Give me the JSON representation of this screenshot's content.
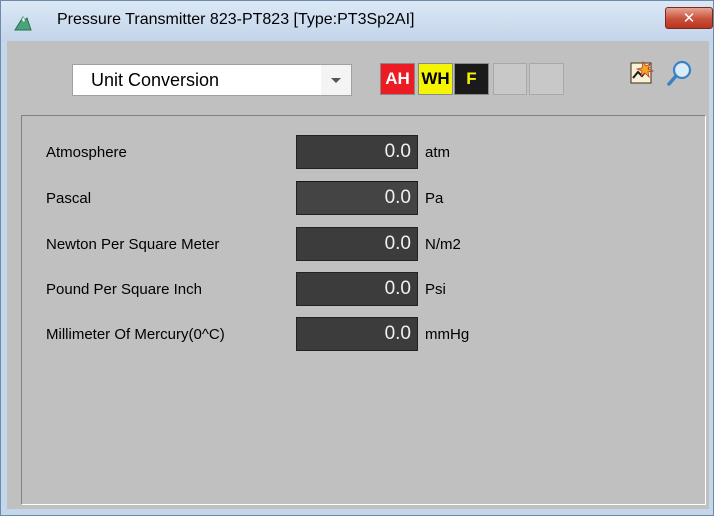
{
  "window": {
    "title": "Pressure Transmitter 823-PT823  [Type:PT3Sp2AI]",
    "close_symbol": "✕"
  },
  "toolbar": {
    "view_select": {
      "value": "Unit Conversion"
    },
    "alarms": [
      {
        "label": "AH",
        "bg": "#ec1c24",
        "fg": "#ffffff"
      },
      {
        "label": "WH",
        "bg": "#f5f500",
        "fg": "#000000"
      },
      {
        "label": "F",
        "bg": "#1a1a1a",
        "fg": "#f5f500"
      },
      {
        "label": "",
        "bg": "#c8c8c8"
      },
      {
        "label": "",
        "bg": "#c8c8c8"
      }
    ],
    "icons": [
      "trend-icon",
      "magnifier-icon"
    ]
  },
  "conversions": [
    {
      "label": "Atmosphere",
      "value": "0.0",
      "unit": "atm"
    },
    {
      "label": "Pascal",
      "value": "0.0",
      "unit": "Pa"
    },
    {
      "label": "Newton Per Square Meter",
      "value": "0.0",
      "unit": "N/m2"
    },
    {
      "label": "Pound Per Square Inch",
      "value": "0.0",
      "unit": "Psi"
    },
    {
      "label": "Millimeter Of Mercury(0^C)",
      "value": "0.0",
      "unit": "mmHg"
    }
  ]
}
